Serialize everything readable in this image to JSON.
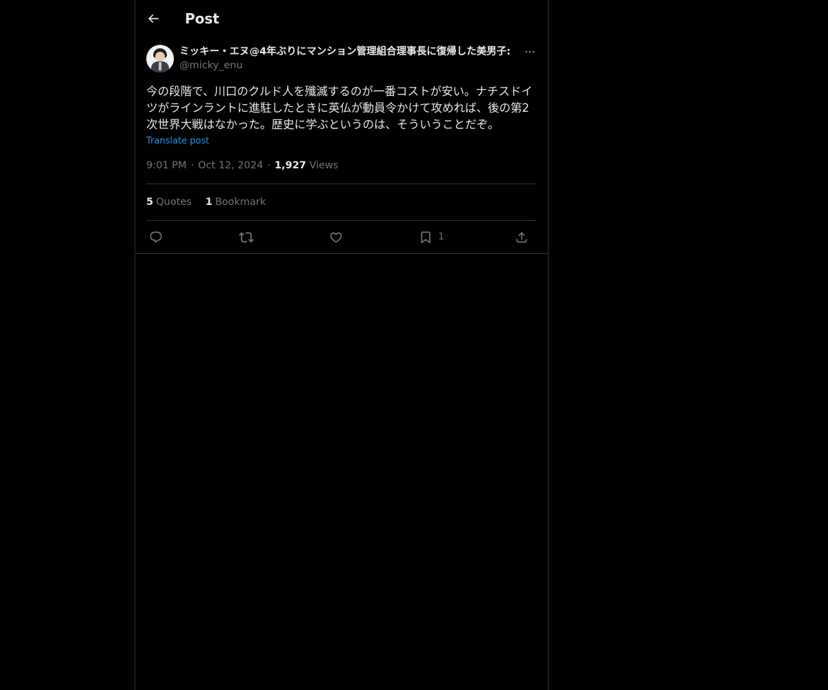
{
  "header": {
    "title": "Post",
    "back_icon": "arrow-left-icon"
  },
  "post": {
    "author": {
      "display_name": "ミッキー・エヌ@4年ぶりにマンション管理組合理事長に復帰した美男子:",
      "handle": "@micky_enu"
    },
    "text": "今の段階で、川口のクルド人を殲滅するのが一番コストが安い。ナチスドイツがラインラントに進駐したときに英仏が動員令かけて攻めれば、後の第2次世界大戦はなかった。歴史に学ぶというのは、そういうことだぞ。",
    "translate_label": "Translate post",
    "time": "9:01 PM",
    "date": "Oct 12, 2024",
    "views_count": "1,927",
    "views_label": "Views",
    "separator": "·",
    "stats": {
      "quotes_count": "5",
      "quotes_label": "Quotes",
      "bookmarks_count": "1",
      "bookmarks_label": "Bookmark"
    },
    "actions": {
      "reply_icon": "reply-icon",
      "repost_icon": "repost-icon",
      "like_icon": "heart-icon",
      "bookmark_icon": "bookmark-icon",
      "bookmark_count": "1",
      "share_icon": "share-icon"
    }
  },
  "colors": {
    "background": "#000000",
    "text_primary": "#e7e9ea",
    "text_secondary": "#71767b",
    "border": "#2f3336",
    "link": "#1d9bf0"
  }
}
